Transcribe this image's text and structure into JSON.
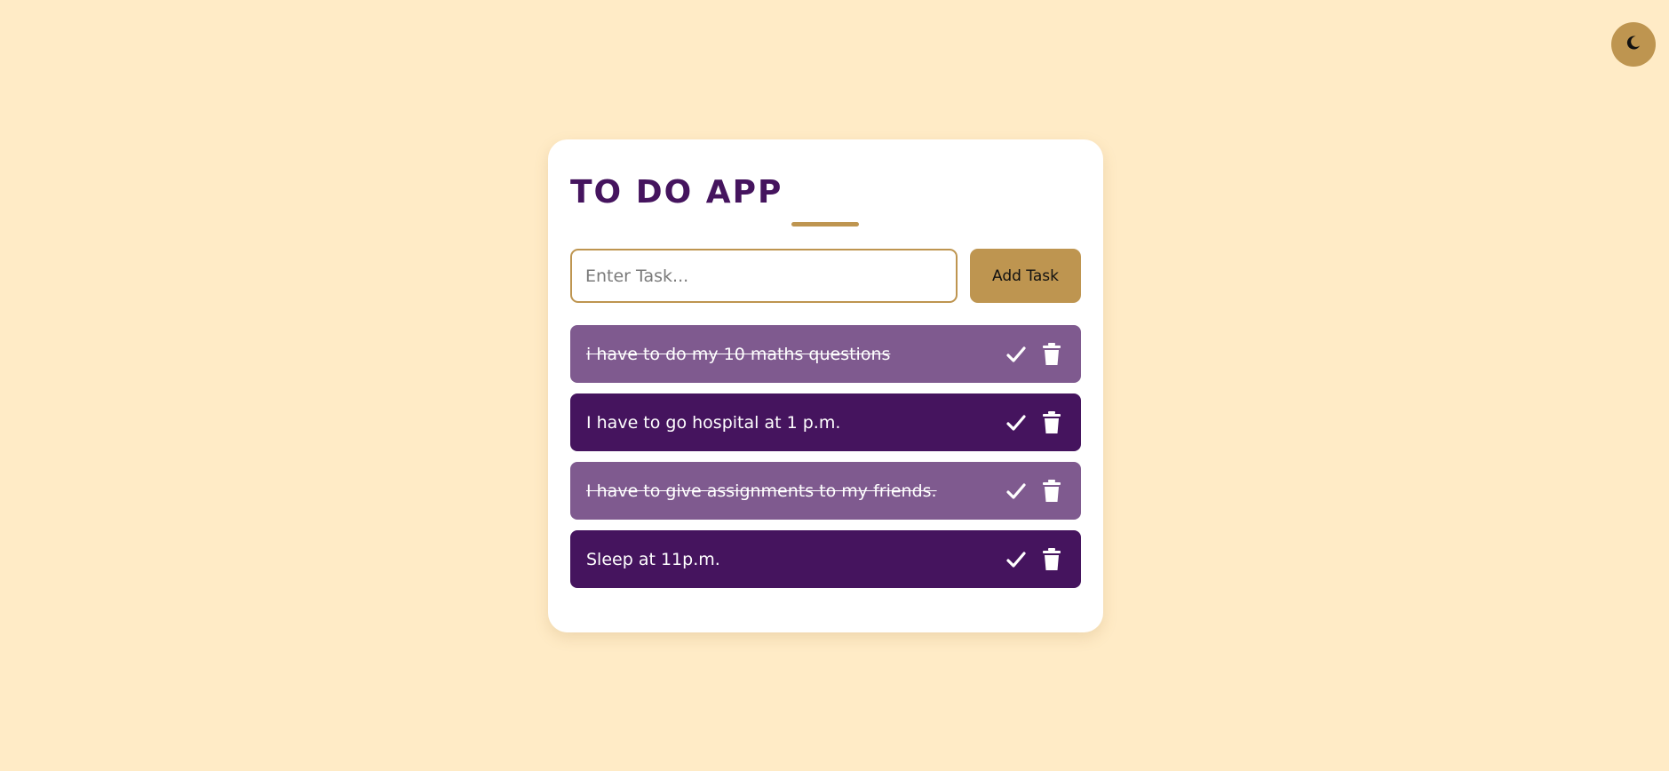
{
  "theme_toggle": {
    "icon": "moon-icon"
  },
  "app": {
    "title": "TO DO APP",
    "input_placeholder": "Enter Task...",
    "input_value": "",
    "add_button_label": "Add Task"
  },
  "tasks": [
    {
      "text": "i have to do my 10 maths questions",
      "completed": true
    },
    {
      "text": "I have to go hospital at 1 p.m.",
      "completed": false
    },
    {
      "text": "I have to give assignments to my friends.",
      "completed": true
    },
    {
      "text": "Sleep at 11p.m.",
      "completed": false
    }
  ],
  "colors": {
    "background": "#ffebc6",
    "accent": "#be9550",
    "task_active": "#45145e",
    "task_completed": "#7f5a8f",
    "title": "#45145e"
  }
}
